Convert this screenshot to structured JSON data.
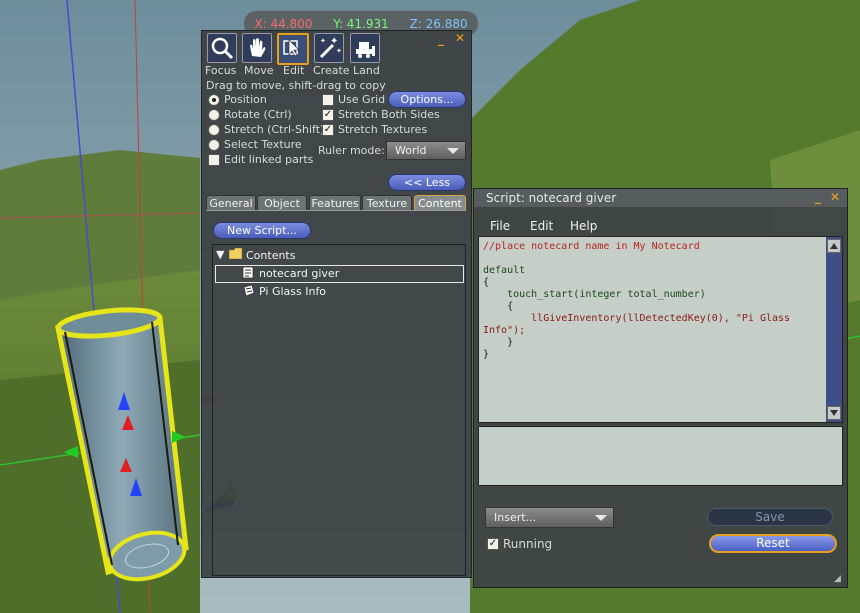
{
  "coords": {
    "x": "X: 44.800",
    "y": "Y: 41.931",
    "z": "Z: 26.880"
  },
  "build_panel": {
    "tools": [
      {
        "label": "Focus",
        "icon": "magnifier-icon"
      },
      {
        "label": "Move",
        "icon": "hand-icon"
      },
      {
        "label": "Edit",
        "icon": "pointer-cube-icon"
      },
      {
        "label": "Create",
        "icon": "magic-wand-icon"
      },
      {
        "label": "Land",
        "icon": "bulldozer-icon"
      }
    ],
    "hint": "Drag to move, shift-drag to copy",
    "modes": [
      "Position",
      "Rotate (Ctrl)",
      "Stretch (Ctrl-Shift)",
      "Select Texture"
    ],
    "edit_linked": "Edit linked parts",
    "use_grid": "Use Grid",
    "options_btn": "Options...",
    "stretch_both": "Stretch Both Sides",
    "stretch_textures": "Stretch Textures",
    "ruler_label": "Ruler mode:",
    "ruler_value": "World",
    "less_btn": "<< Less",
    "tabs": [
      "General",
      "Object",
      "Features",
      "Texture",
      "Content"
    ],
    "new_script_btn": "New Script...",
    "tree_root": "Contents",
    "tree_items": [
      "notecard giver",
      "Pi Glass Info"
    ]
  },
  "script_window": {
    "title": "Script: notecard giver",
    "menu": [
      "File",
      "Edit",
      "Help"
    ],
    "code": {
      "l1": "//place notecard name in My Notecard",
      "l2": "default",
      "l3": "{",
      "l4": "    touch_start(integer total_number)",
      "l5": "    {",
      "l6": "        llGiveInventory(llDetectedKey(0), \"Pi Glass",
      "l7": "Info\");",
      "l8": "    }",
      "l9": "}"
    },
    "insert_select": "Insert...",
    "save_btn": "Save",
    "running_label": "Running",
    "reset_btn": "Reset"
  },
  "colors": {
    "accent": "#e8a020",
    "button": "#5b6ed0",
    "coord_x": "#ff6a6a",
    "coord_y": "#7cff7c",
    "coord_z": "#7ec8ff"
  }
}
